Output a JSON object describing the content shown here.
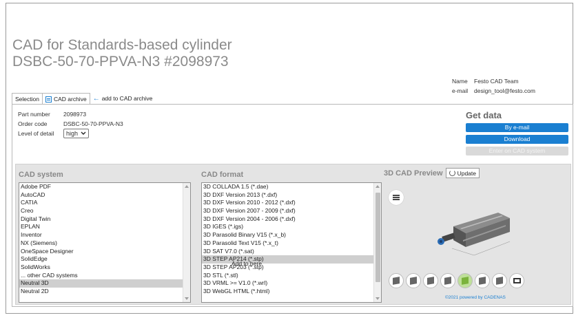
{
  "title": {
    "line1": "CAD for Standards-based cylinder",
    "line2": "DSBC-50-70-PPVA-N3 #2098973"
  },
  "contact": {
    "name_key": "Name",
    "name_val": "Festo CAD Team",
    "email_key": "e-mail",
    "email_val": "design_tool@festo.com"
  },
  "tabs": {
    "selection": "Selection",
    "archive": "CAD archive",
    "add": "add to CAD archive"
  },
  "info": {
    "part_key": "Part number",
    "part_val": "2098973",
    "order_key": "Order code",
    "order_val": "DSBC-50-70-PPVA-N3",
    "level_key": "Level of detail",
    "level_val": "high"
  },
  "getdata": {
    "title": "Get data",
    "email_btn": "By e-mail",
    "download_btn": "Download",
    "enter_btn": "Enter on CAD system"
  },
  "cad_system": {
    "title": "CAD system",
    "items": [
      "Adobe PDF",
      "AutoCAD",
      "CATIA",
      "Creo",
      "Digital Twin",
      "EPLAN",
      "Inventor",
      "NX (Siemens)",
      "OneSpace Designer",
      "SolidEdge",
      "SolidWorks",
      "... other CAD systems",
      "Neutral 3D",
      "Neutral 2D"
    ],
    "selected_index": 12
  },
  "cad_format": {
    "title": "CAD format",
    "items": [
      "3D COLLADA 1.5 (*.dae)",
      "3D DXF Version 2013 (*.dxf)",
      "3D DXF Version 2010 - 2012 (*.dxf)",
      "3D DXF Version 2007 - 2009 (*.dxf)",
      "3D DXF Version 2004 - 2006 (*.dxf)",
      "3D IGES (*.igs)",
      "3D Parasolid Binary V15 (*.x_b)",
      "3D Parasolid Text V15 (*.x_t)",
      "3D SAT V7.0 (*.sat)",
      "3D STEP AP214 (*.stp)",
      "3D STEP AP203 (*.stp)",
      "3D STL (*.stl)",
      "3D VRML >= V1.0 (*.wrl)",
      "3D WebGL HTML (*.html)"
    ],
    "selected_index": 9
  },
  "preview": {
    "title": "3D CAD Preview",
    "update": "Update",
    "powered": "©2021 powered by CADENAS",
    "view_icons": [
      "iso-solid-icon",
      "iso-wire-icon",
      "front-cube-icon",
      "side-cube-icon",
      "cylinder-view-icon",
      "mesh-icon",
      "shaded-icon",
      "screen-icon"
    ]
  },
  "tooltip": "Add to here",
  "colors": {
    "accent": "#1a7fd1",
    "selected_row": "#cfcfcf"
  }
}
